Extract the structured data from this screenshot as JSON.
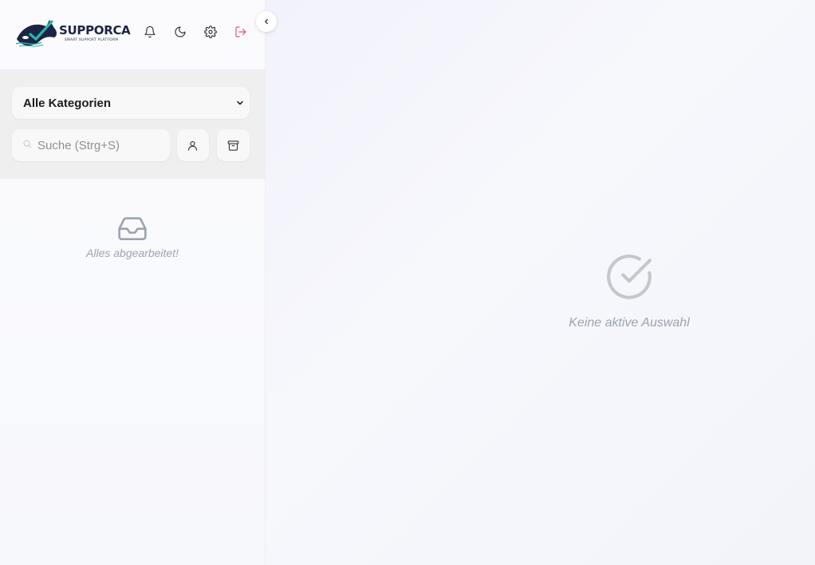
{
  "brand": {
    "name": "SUPPORCA",
    "tagline": "SMART SUPPORT PLATFORM",
    "colors": {
      "navy": "#1b2445",
      "teal": "#2bb5a5",
      "logout": "#e0566e"
    }
  },
  "header": {
    "icons": [
      "bell-icon",
      "moon-icon",
      "gear-icon",
      "logout-icon"
    ]
  },
  "filters": {
    "category_selected": "Alle Kategorien",
    "search_placeholder": "Suche (Strg+S)",
    "search_value": ""
  },
  "list": {
    "empty_message": "Alles abgearbeitet!"
  },
  "main": {
    "empty_message": "Keine aktive Auswahl"
  }
}
